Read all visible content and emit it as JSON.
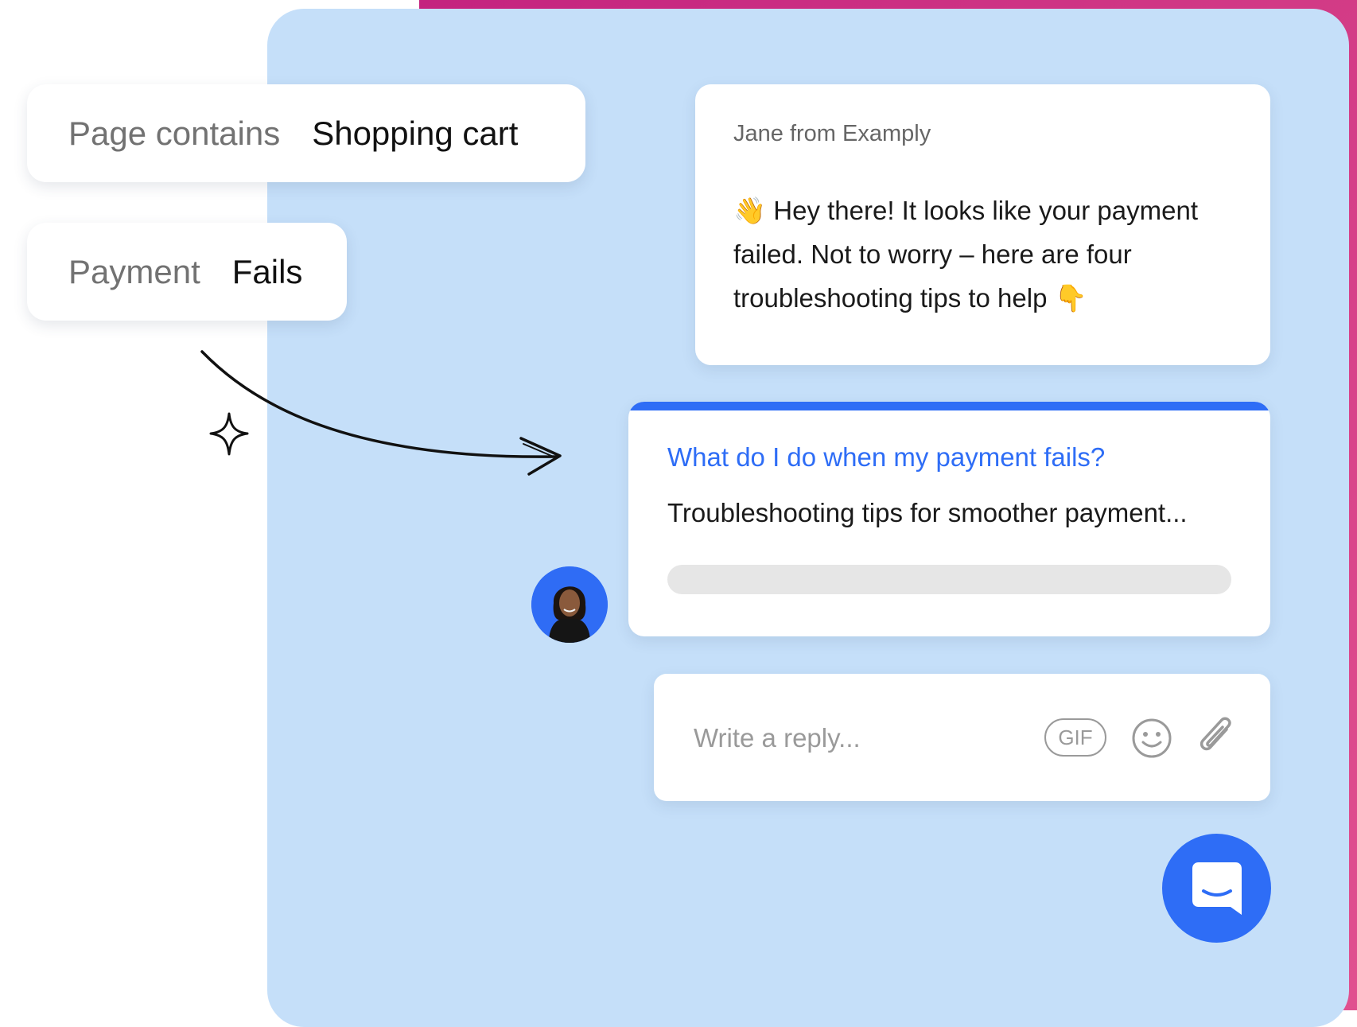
{
  "conditions": [
    {
      "key": "Page contains",
      "value": "Shopping cart"
    },
    {
      "key": "Payment",
      "value": "Fails"
    }
  ],
  "message": {
    "sender": "Jane from Examply",
    "body": "Hey there! It looks like your payment failed. Not to worry – here are four troubleshooting tips to help",
    "wave_emoji": "👋",
    "point_emoji": "👇"
  },
  "article": {
    "title": "What do I do when my payment fails?",
    "description": "Troubleshooting tips for smoother payment..."
  },
  "reply": {
    "placeholder": "Write a reply...",
    "gif_label": "GIF"
  },
  "colors": {
    "brand_blue": "#2e6df6",
    "panel_blue": "#c5dff9",
    "magenta": "#c4237f"
  },
  "icons": [
    "sparkle-icon",
    "curved-arrow-icon",
    "smiley-icon",
    "paperclip-icon",
    "chat-bubble-icon",
    "avatar"
  ]
}
